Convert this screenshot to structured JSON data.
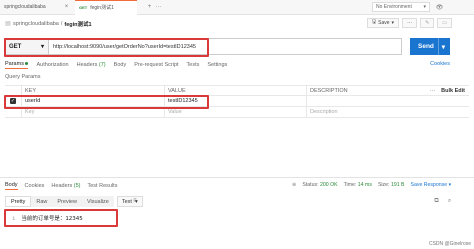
{
  "tabs": [
    {
      "label": "springcloudalibaba",
      "method": "",
      "active": false
    },
    {
      "label": "fegin测试1",
      "method": "GET",
      "active": true
    }
  ],
  "environment": "No Environment",
  "breadcrumb": {
    "parent": "springcloudalibaba",
    "separator": "/",
    "current": "fegin测试1"
  },
  "title_actions": {
    "save_label": "Save"
  },
  "request": {
    "method": "GET",
    "url": "http://localhost:9090/user/getOrderNo?userId=testID12345",
    "send_label": "Send"
  },
  "request_tabs": [
    {
      "label": "Params",
      "count": "",
      "active": true
    },
    {
      "label": "Authorization",
      "count": "",
      "active": false
    },
    {
      "label": "Headers",
      "count": "(7)",
      "active": false
    },
    {
      "label": "Body",
      "count": "",
      "active": false
    },
    {
      "label": "Pre-request Script",
      "count": "",
      "active": false
    },
    {
      "label": "Tests",
      "count": "",
      "active": false
    },
    {
      "label": "Settings",
      "count": "",
      "active": false
    }
  ],
  "cookies_label": "Cookies",
  "query_params": {
    "section_label": "Query Params",
    "headers": {
      "key": "KEY",
      "value": "VALUE",
      "description": "DESCRIPTION",
      "bulk_edit": "Bulk Edit"
    },
    "rows": [
      {
        "checked": true,
        "key": "userId",
        "value": "testID12345",
        "description": ""
      }
    ],
    "placeholder": {
      "key": "Key",
      "value": "Value",
      "description": "Description"
    }
  },
  "response": {
    "tabs": [
      {
        "label": "Body",
        "count": "",
        "active": true
      },
      {
        "label": "Cookies",
        "count": "",
        "active": false
      },
      {
        "label": "Headers",
        "count": "(5)",
        "active": false
      },
      {
        "label": "Test Results",
        "count": "",
        "active": false
      }
    ],
    "status_label": "Status:",
    "status_value": "200 OK",
    "time_label": "Time:",
    "time_value": "14 ms",
    "size_label": "Size:",
    "size_value": "191 B",
    "save_response_label": "Save Response",
    "view_modes": [
      "Pretty",
      "Raw",
      "Preview",
      "Visualize"
    ],
    "active_view_mode": "Pretty",
    "format": "Text",
    "body_lines": [
      {
        "line": "1",
        "text": "当前的订单号是：12345"
      }
    ]
  },
  "watermark": "CSDN @Ginelrose",
  "colors": {
    "accent": "#f26b3a",
    "send": "#1a75d0",
    "highlight_box": "#d93939",
    "status_ok": "#2a8a3a"
  }
}
